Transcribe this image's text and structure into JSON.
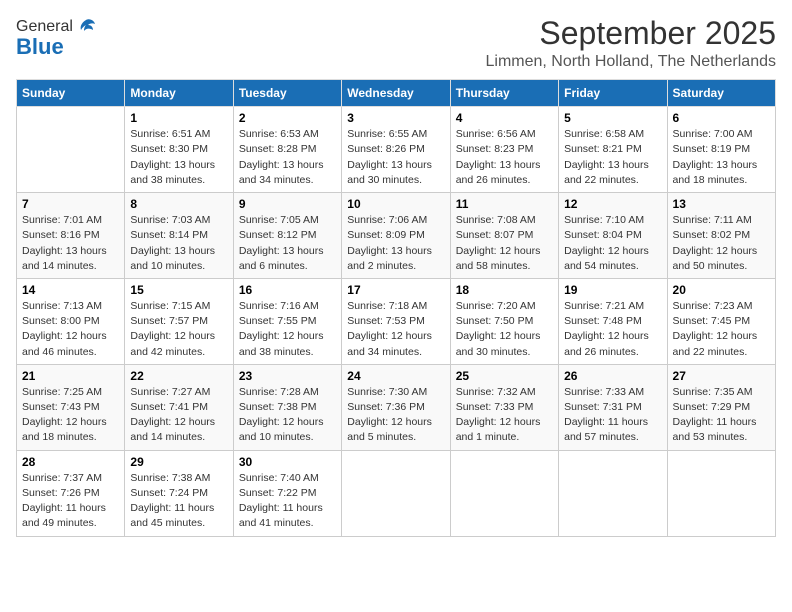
{
  "header": {
    "logo_general": "General",
    "logo_blue": "Blue",
    "month_title": "September 2025",
    "location": "Limmen, North Holland, The Netherlands"
  },
  "weekdays": [
    "Sunday",
    "Monday",
    "Tuesday",
    "Wednesday",
    "Thursday",
    "Friday",
    "Saturday"
  ],
  "weeks": [
    [
      {
        "day": "",
        "info": ""
      },
      {
        "day": "1",
        "info": "Sunrise: 6:51 AM\nSunset: 8:30 PM\nDaylight: 13 hours\nand 38 minutes."
      },
      {
        "day": "2",
        "info": "Sunrise: 6:53 AM\nSunset: 8:28 PM\nDaylight: 13 hours\nand 34 minutes."
      },
      {
        "day": "3",
        "info": "Sunrise: 6:55 AM\nSunset: 8:26 PM\nDaylight: 13 hours\nand 30 minutes."
      },
      {
        "day": "4",
        "info": "Sunrise: 6:56 AM\nSunset: 8:23 PM\nDaylight: 13 hours\nand 26 minutes."
      },
      {
        "day": "5",
        "info": "Sunrise: 6:58 AM\nSunset: 8:21 PM\nDaylight: 13 hours\nand 22 minutes."
      },
      {
        "day": "6",
        "info": "Sunrise: 7:00 AM\nSunset: 8:19 PM\nDaylight: 13 hours\nand 18 minutes."
      }
    ],
    [
      {
        "day": "7",
        "info": "Sunrise: 7:01 AM\nSunset: 8:16 PM\nDaylight: 13 hours\nand 14 minutes."
      },
      {
        "day": "8",
        "info": "Sunrise: 7:03 AM\nSunset: 8:14 PM\nDaylight: 13 hours\nand 10 minutes."
      },
      {
        "day": "9",
        "info": "Sunrise: 7:05 AM\nSunset: 8:12 PM\nDaylight: 13 hours\nand 6 minutes."
      },
      {
        "day": "10",
        "info": "Sunrise: 7:06 AM\nSunset: 8:09 PM\nDaylight: 13 hours\nand 2 minutes."
      },
      {
        "day": "11",
        "info": "Sunrise: 7:08 AM\nSunset: 8:07 PM\nDaylight: 12 hours\nand 58 minutes."
      },
      {
        "day": "12",
        "info": "Sunrise: 7:10 AM\nSunset: 8:04 PM\nDaylight: 12 hours\nand 54 minutes."
      },
      {
        "day": "13",
        "info": "Sunrise: 7:11 AM\nSunset: 8:02 PM\nDaylight: 12 hours\nand 50 minutes."
      }
    ],
    [
      {
        "day": "14",
        "info": "Sunrise: 7:13 AM\nSunset: 8:00 PM\nDaylight: 12 hours\nand 46 minutes."
      },
      {
        "day": "15",
        "info": "Sunrise: 7:15 AM\nSunset: 7:57 PM\nDaylight: 12 hours\nand 42 minutes."
      },
      {
        "day": "16",
        "info": "Sunrise: 7:16 AM\nSunset: 7:55 PM\nDaylight: 12 hours\nand 38 minutes."
      },
      {
        "day": "17",
        "info": "Sunrise: 7:18 AM\nSunset: 7:53 PM\nDaylight: 12 hours\nand 34 minutes."
      },
      {
        "day": "18",
        "info": "Sunrise: 7:20 AM\nSunset: 7:50 PM\nDaylight: 12 hours\nand 30 minutes."
      },
      {
        "day": "19",
        "info": "Sunrise: 7:21 AM\nSunset: 7:48 PM\nDaylight: 12 hours\nand 26 minutes."
      },
      {
        "day": "20",
        "info": "Sunrise: 7:23 AM\nSunset: 7:45 PM\nDaylight: 12 hours\nand 22 minutes."
      }
    ],
    [
      {
        "day": "21",
        "info": "Sunrise: 7:25 AM\nSunset: 7:43 PM\nDaylight: 12 hours\nand 18 minutes."
      },
      {
        "day": "22",
        "info": "Sunrise: 7:27 AM\nSunset: 7:41 PM\nDaylight: 12 hours\nand 14 minutes."
      },
      {
        "day": "23",
        "info": "Sunrise: 7:28 AM\nSunset: 7:38 PM\nDaylight: 12 hours\nand 10 minutes."
      },
      {
        "day": "24",
        "info": "Sunrise: 7:30 AM\nSunset: 7:36 PM\nDaylight: 12 hours\nand 5 minutes."
      },
      {
        "day": "25",
        "info": "Sunrise: 7:32 AM\nSunset: 7:33 PM\nDaylight: 12 hours\nand 1 minute."
      },
      {
        "day": "26",
        "info": "Sunrise: 7:33 AM\nSunset: 7:31 PM\nDaylight: 11 hours\nand 57 minutes."
      },
      {
        "day": "27",
        "info": "Sunrise: 7:35 AM\nSunset: 7:29 PM\nDaylight: 11 hours\nand 53 minutes."
      }
    ],
    [
      {
        "day": "28",
        "info": "Sunrise: 7:37 AM\nSunset: 7:26 PM\nDaylight: 11 hours\nand 49 minutes."
      },
      {
        "day": "29",
        "info": "Sunrise: 7:38 AM\nSunset: 7:24 PM\nDaylight: 11 hours\nand 45 minutes."
      },
      {
        "day": "30",
        "info": "Sunrise: 7:40 AM\nSunset: 7:22 PM\nDaylight: 11 hours\nand 41 minutes."
      },
      {
        "day": "",
        "info": ""
      },
      {
        "day": "",
        "info": ""
      },
      {
        "day": "",
        "info": ""
      },
      {
        "day": "",
        "info": ""
      }
    ]
  ]
}
